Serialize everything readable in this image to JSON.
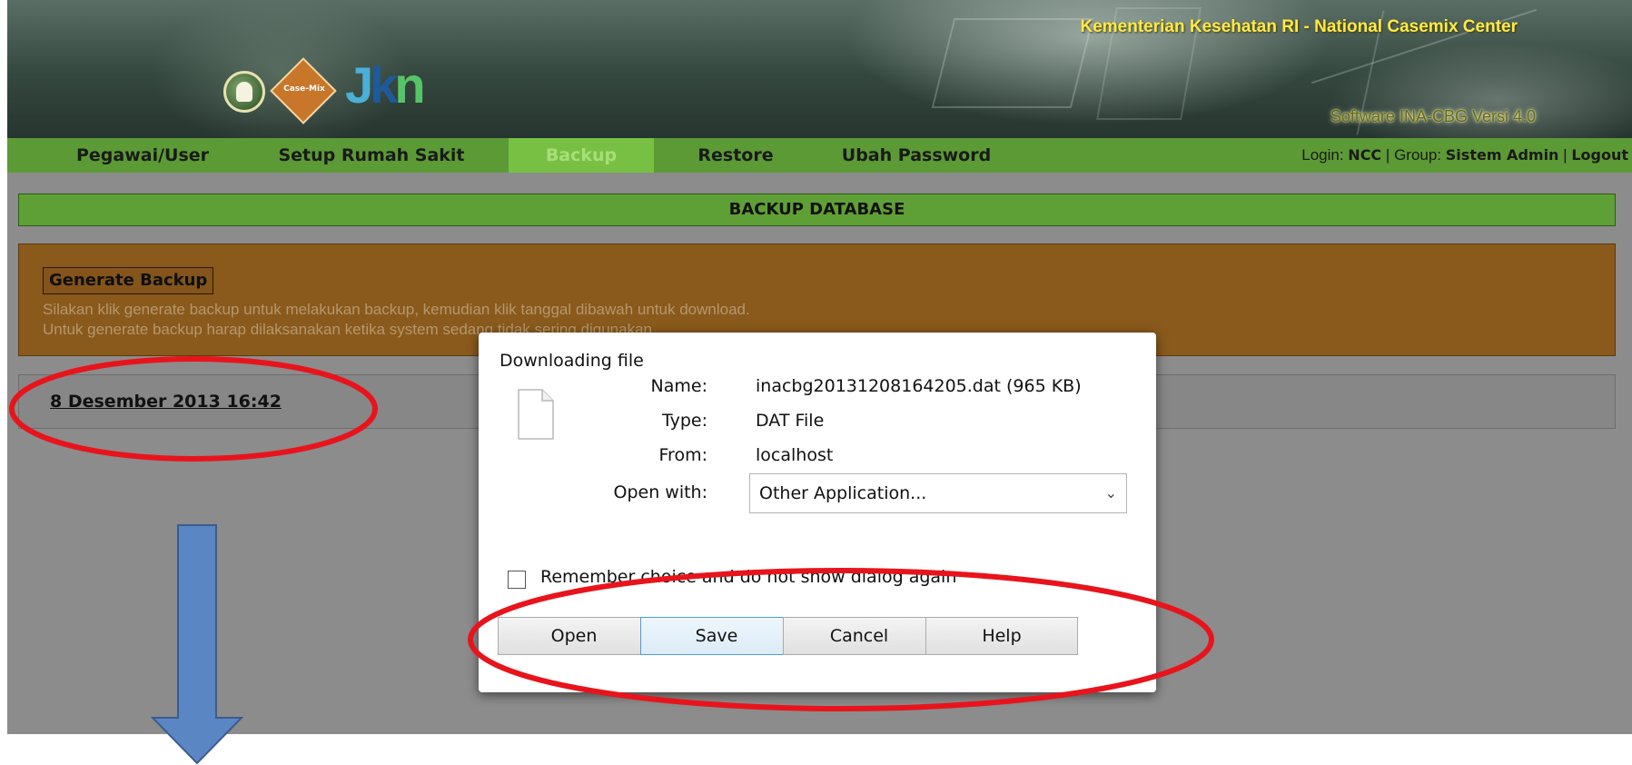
{
  "header": {
    "agency": "Kementerian Kesehatan RI - National Casemix Center",
    "version": "Software INA-CBG Versi 4.0",
    "logos": [
      "kemenkes-logo",
      "casemix-logo",
      "jkn-logo"
    ],
    "casemix_text": "Case-Mix",
    "jkn_text": {
      "j": "J",
      "k": "k",
      "n": "n"
    }
  },
  "nav": {
    "items": [
      {
        "label": "Pegawai/User"
      },
      {
        "label": "Setup Rumah Sakit"
      },
      {
        "label": "Backup",
        "active": true
      },
      {
        "label": "Restore"
      },
      {
        "label": "Ubah Password"
      }
    ],
    "login": {
      "login_label": "Login:",
      "login_user": "NCC",
      "sep1": "|",
      "group_label": "Group:",
      "group_name": "Sistem Admin",
      "sep2": "|",
      "logout": "Logout"
    }
  },
  "section": {
    "title": "BACKUP DATABASE"
  },
  "info": {
    "generate_button": "Generate Backup",
    "line1": "Silakan klik generate backup untuk melakukan backup, kemudian klik tanggal dibawah untuk download.",
    "line2": "Untuk generate backup harap dilaksanakan ketika system sedang tidak sering digunakan"
  },
  "backups": [
    {
      "label": "8 Desember 2013 16:42"
    }
  ],
  "dialog": {
    "title": "Downloading file",
    "name_label": "Name:",
    "name_value": "inacbg20131208164205.dat (965 KB)",
    "type_label": "Type:",
    "type_value": "DAT File",
    "from_label": "From:",
    "from_value": "localhost",
    "open_with_label": "Open with:",
    "open_with_value": "Other Application...",
    "remember_checked": false,
    "remember_label": "Remember choice and do not show dialog again",
    "buttons": {
      "open": "Open",
      "save": "Save",
      "cancel": "Cancel",
      "help": "Help"
    }
  },
  "colors": {
    "nav_green": "#5c9a35",
    "nav_active": "#78c044",
    "title_green": "#5fa036",
    "panel_brown": "#8a5a1c",
    "agency_yellow": "#ffe94a",
    "annotation_red": "#e8141c",
    "arrow_blue": "#5b86c4"
  },
  "icons": [
    "file-icon",
    "chevron-down-icon"
  ]
}
